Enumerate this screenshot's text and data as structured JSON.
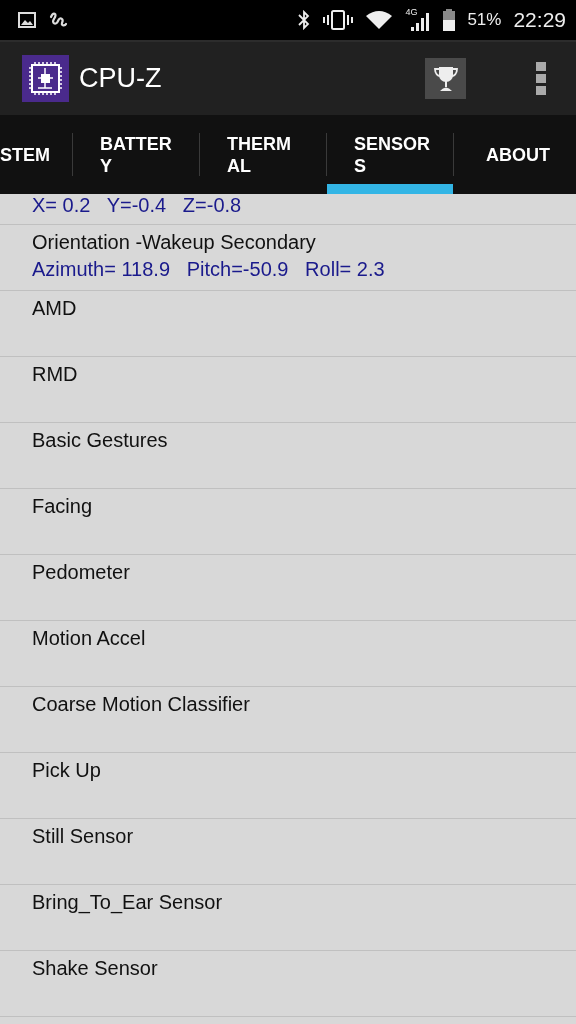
{
  "status_bar": {
    "network": "4G",
    "battery": "51%",
    "time": "22:29"
  },
  "app_bar": {
    "title": "CPU-Z"
  },
  "tabs": [
    {
      "label": "STEM",
      "selected": false
    },
    {
      "label": "BATTER\nY",
      "selected": false
    },
    {
      "label": "THERM\nAL",
      "selected": false
    },
    {
      "label": "SENSOR\nS",
      "selected": true
    },
    {
      "label": "ABOUT",
      "selected": false
    }
  ],
  "sensors": [
    {
      "values": "X= 0.2   Y=-0.4   Z=-0.8"
    },
    {
      "name": "Orientation -Wakeup Secondary",
      "values": "Azimuth= 118.9   Pitch=-50.9   Roll= 2.3"
    },
    {
      "name": "AMD"
    },
    {
      "name": "RMD"
    },
    {
      "name": "Basic Gestures"
    },
    {
      "name": "Facing"
    },
    {
      "name": "Pedometer"
    },
    {
      "name": "Motion Accel"
    },
    {
      "name": "Coarse Motion Classifier"
    },
    {
      "name": "Pick Up"
    },
    {
      "name": "Still Sensor"
    },
    {
      "name": "Bring_To_Ear Sensor"
    },
    {
      "name": "Shake Sensor"
    }
  ]
}
